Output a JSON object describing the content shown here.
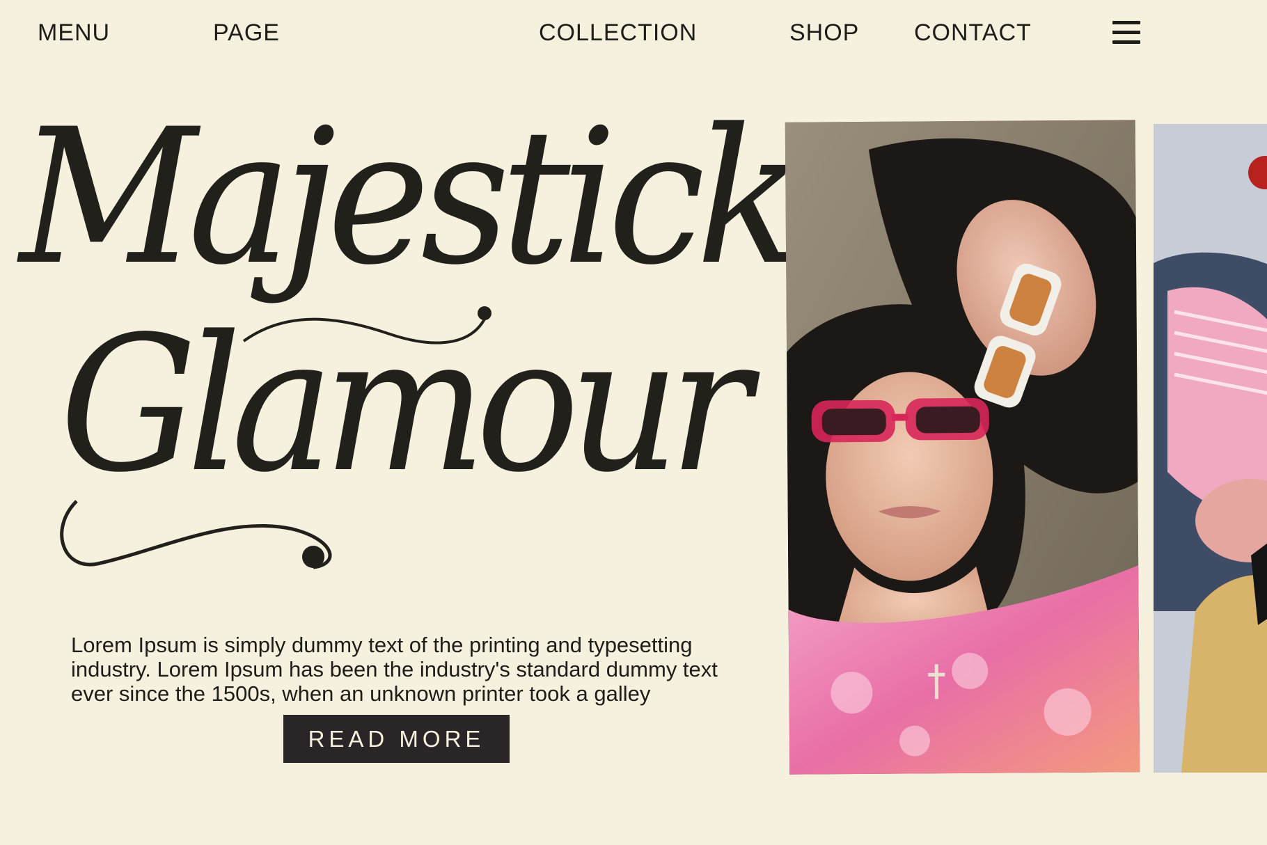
{
  "nav": {
    "menu": "MENU",
    "page": "PAGE",
    "collection": "COLLECTION",
    "shop": "SHOP",
    "contact": "CONTACT",
    "hamburger_icon": "hamburger-menu-icon"
  },
  "hero": {
    "headline_line1": "Majestick",
    "headline_line2": "Glamour",
    "body": "Lorem Ipsum is simply dummy text of the printing and typesetting industry. Lorem Ipsum has been the industry's standard dummy text ever since the 1500s, when an unknown printer took a galley",
    "button_label": "READ MORE"
  },
  "colors": {
    "background": "#f6f1de",
    "text": "#1f1d17",
    "button_bg": "#2a2526",
    "button_text": "#f6f1de"
  }
}
